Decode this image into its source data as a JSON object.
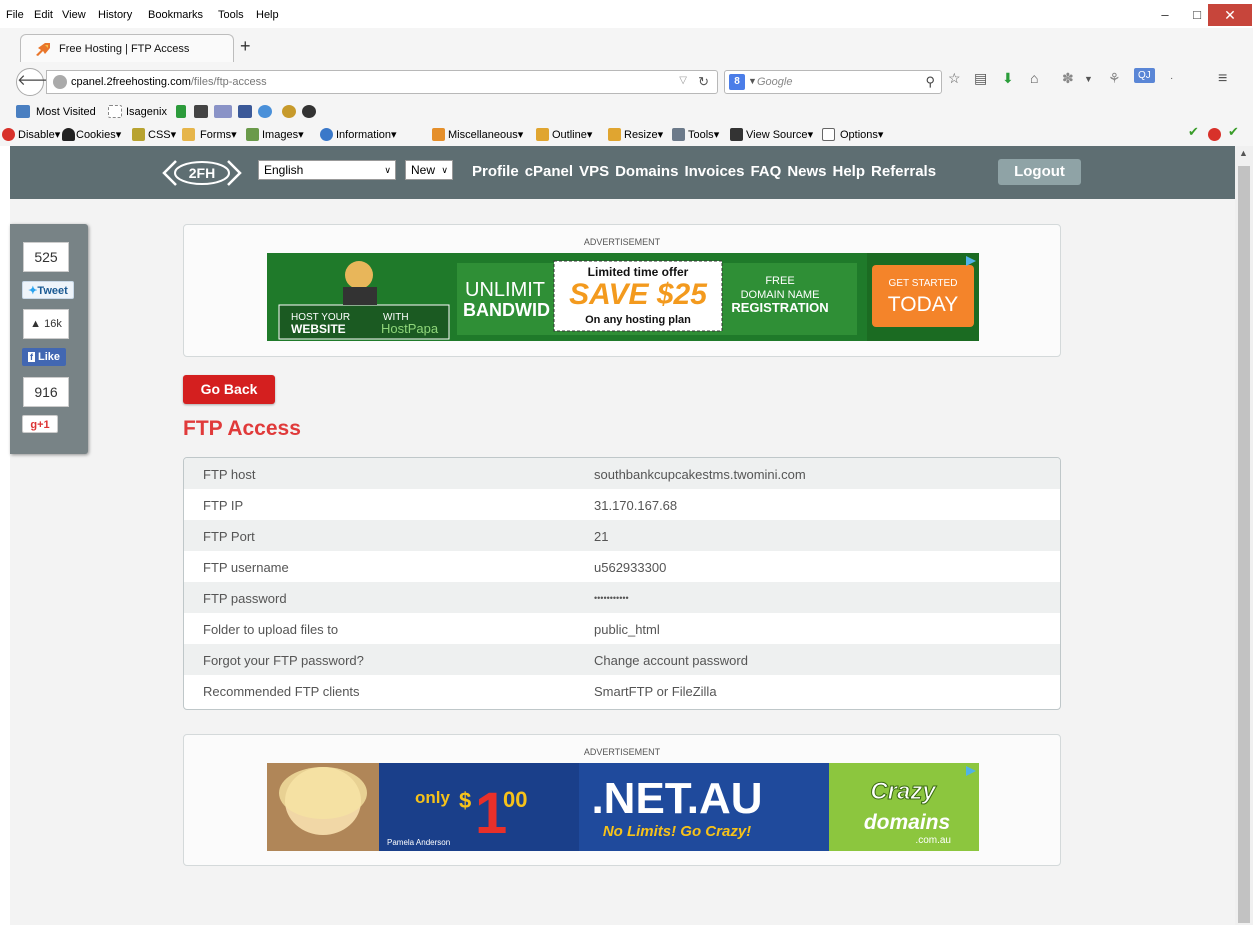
{
  "browser": {
    "menu": [
      "File",
      "Edit",
      "View",
      "History",
      "Bookmarks",
      "Tools",
      "Help"
    ],
    "tab_title": "Free Hosting | FTP Access",
    "new_tab": "+",
    "url_host": "cpanel.2freehosting.com",
    "url_path": "/files/ftp-access",
    "search_engine": "8",
    "search_placeholder": "Google",
    "bookmarks": [
      "Most Visited",
      "Isagenix"
    ],
    "dev_toolbar": [
      "Disable",
      "Cookies",
      "CSS",
      "Forms",
      "Images",
      "Information",
      "Miscellaneous",
      "Outline",
      "Resize",
      "Tools",
      "View Source",
      "Options"
    ],
    "colors": {
      "accent_close": "#c7453b"
    }
  },
  "site": {
    "logo_text": "2FH",
    "language": "English",
    "new_select": "New",
    "nav": [
      "Profile",
      "cPanel",
      "VPS",
      "Domains",
      "Invoices",
      "FAQ",
      "News",
      "Help",
      "Referrals"
    ],
    "logout": "Logout",
    "colors": {
      "header_bg": "#5e6e72",
      "go_back": "#d41f1f",
      "title": "#e03a3a"
    }
  },
  "share": {
    "tweet_count": "525",
    "tweet_label": "Tweet",
    "like_count": "16k",
    "like_label": "Like",
    "gplus_count": "916",
    "gplus_label": "+1"
  },
  "ads": {
    "label": "ADVERTISEMENT",
    "top": {
      "host_your": "HOST YOUR",
      "website": "WEBSITE",
      "with": "WITH",
      "brand": "HostPapa",
      "unlimited": "UNLIMIT",
      "bandwidth": "BANDWID",
      "offer": "Limited time offer",
      "save": "SAVE $25",
      "offer_sub": "On any hosting plan",
      "free": "FREE",
      "domain": "DOMAIN NAME",
      "registration": "REGISTRATION",
      "cta_top": "GET STARTED",
      "cta": "TODAY"
    },
    "bottom": {
      "only": "only",
      "price_dollar": "$",
      "price_one": "1",
      "price_cents": "00",
      "tld": ".NET.AU",
      "tagline": "No Limits! Go Crazy!",
      "brand_top": "Crazy",
      "brand_mid": "domains",
      "brand_bot": ".com.au",
      "celebrity": "Pamela Anderson"
    }
  },
  "main": {
    "go_back": "Go Back",
    "title": "FTP Access",
    "rows": [
      {
        "label": "FTP host",
        "value": "southbankcupcakestms.twomini.com"
      },
      {
        "label": "FTP IP",
        "value": "31.170.167.68"
      },
      {
        "label": "FTP Port",
        "value": "21"
      },
      {
        "label": "FTP username",
        "value": "u562933300"
      },
      {
        "label": "FTP password",
        "value": "•••••••••••"
      },
      {
        "label": "Folder to upload files to",
        "value": "public_html"
      },
      {
        "label": "Forgot your FTP password?",
        "value": "Change account password"
      },
      {
        "label": "Recommended FTP clients",
        "value": "SmartFTP or FileZilla"
      }
    ]
  }
}
